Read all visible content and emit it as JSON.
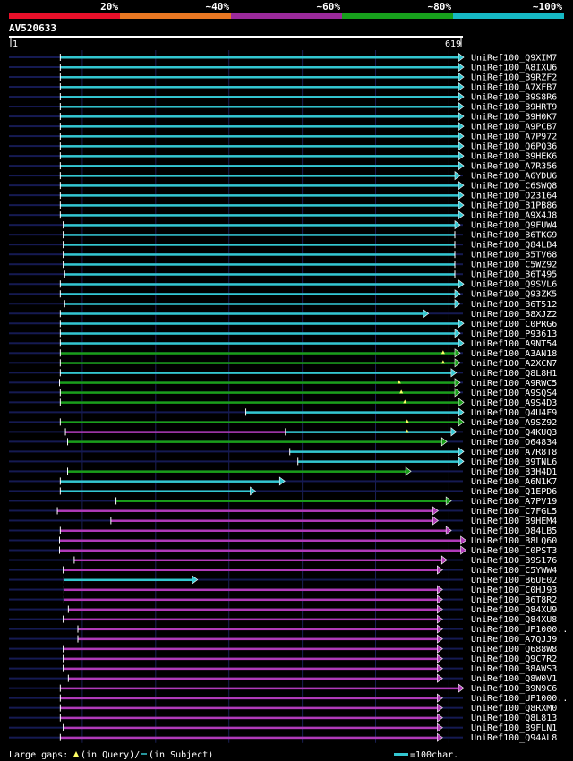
{
  "query_id": "AV520633",
  "identity_scale": [
    {
      "label": "20%",
      "color": "#e8102a"
    },
    {
      "label": "~40%",
      "color": "#e87722"
    },
    {
      "label": "~60%",
      "color": "#9b2a9b"
    },
    {
      "label": "~80%",
      "color": "#17a01c"
    },
    {
      "label": "~100%",
      "color": "#16b9c4"
    }
  ],
  "ruler": {
    "start": "1",
    "end": "619",
    "length": 619
  },
  "legend": {
    "large_gaps": "Large gaps:",
    "in_query": "(in Query)/",
    "in_subject": "(in Subject)",
    "scale_text": "=100char.",
    "gap_icon": "triangle-icon"
  },
  "hits": [
    {
      "id": "UniRef100_Q9XIM7",
      "start": 70,
      "end": 613,
      "color": "teal",
      "arrow": true
    },
    {
      "id": "UniRef100_A8IXU6",
      "start": 70,
      "end": 613,
      "color": "teal",
      "arrow": true
    },
    {
      "id": "UniRef100_B9RZF2",
      "start": 70,
      "end": 613,
      "color": "teal",
      "arrow": true
    },
    {
      "id": "UniRef100_A7XFB7",
      "start": 70,
      "end": 613,
      "color": "teal",
      "arrow": true
    },
    {
      "id": "UniRef100_B9S8R6",
      "start": 70,
      "end": 613,
      "color": "teal",
      "arrow": true
    },
    {
      "id": "UniRef100_B9HRT9",
      "start": 70,
      "end": 613,
      "color": "teal",
      "arrow": true
    },
    {
      "id": "UniRef100_B9H0K7",
      "start": 70,
      "end": 613,
      "color": "teal",
      "arrow": true
    },
    {
      "id": "UniRef100_A9PCB7",
      "start": 70,
      "end": 613,
      "color": "teal",
      "arrow": true
    },
    {
      "id": "UniRef100_A7P972",
      "start": 70,
      "end": 613,
      "color": "teal",
      "arrow": true
    },
    {
      "id": "UniRef100_Q6PQ36",
      "start": 70,
      "end": 613,
      "color": "teal",
      "arrow": true
    },
    {
      "id": "UniRef100_B9HEK6",
      "start": 70,
      "end": 613,
      "color": "teal",
      "arrow": true
    },
    {
      "id": "UniRef100_A7R356",
      "start": 70,
      "end": 613,
      "color": "teal",
      "arrow": true
    },
    {
      "id": "UniRef100_A6YDU6",
      "start": 70,
      "end": 608,
      "color": "teal",
      "arrow": true
    },
    {
      "id": "UniRef100_C6SWQ8",
      "start": 70,
      "end": 613,
      "color": "teal",
      "arrow": true
    },
    {
      "id": "UniRef100_O23164",
      "start": 70,
      "end": 613,
      "color": "teal",
      "arrow": true
    },
    {
      "id": "UniRef100_B1PB86",
      "start": 70,
      "end": 613,
      "color": "teal",
      "arrow": true
    },
    {
      "id": "UniRef100_A9X4J8",
      "start": 70,
      "end": 613,
      "color": "teal",
      "arrow": true
    },
    {
      "id": "UniRef100_Q9FUW4",
      "start": 74,
      "end": 608,
      "color": "teal",
      "arrow": true
    },
    {
      "id": "UniRef100_B6TKG9",
      "start": 74,
      "end": 608,
      "color": "teal",
      "arrow": false
    },
    {
      "id": "UniRef100_Q84LB4",
      "start": 74,
      "end": 608,
      "color": "teal",
      "arrow": false
    },
    {
      "id": "UniRef100_B5TV68",
      "start": 74,
      "end": 608,
      "color": "teal",
      "arrow": false
    },
    {
      "id": "UniRef100_C5WZ92",
      "start": 74,
      "end": 608,
      "color": "teal",
      "arrow": false
    },
    {
      "id": "UniRef100_B6T495",
      "start": 76,
      "end": 608,
      "color": "teal",
      "arrow": false
    },
    {
      "id": "UniRef100_Q9SVL6",
      "start": 70,
      "end": 613,
      "color": "teal",
      "arrow": true
    },
    {
      "id": "UniRef100_Q93ZK5",
      "start": 70,
      "end": 608,
      "color": "teal",
      "arrow": true
    },
    {
      "id": "UniRef100_B6T512",
      "start": 76,
      "end": 608,
      "color": "teal",
      "arrow": true
    },
    {
      "id": "UniRef100_B8XJZ2",
      "start": 70,
      "end": 565,
      "color": "teal",
      "arrow": true
    },
    {
      "id": "UniRef100_C0PRG6",
      "start": 70,
      "end": 613,
      "color": "teal",
      "arrow": true
    },
    {
      "id": "UniRef100_P93613",
      "start": 70,
      "end": 608,
      "color": "teal",
      "arrow": true
    },
    {
      "id": "UniRef100_A9NT54",
      "start": 70,
      "end": 613,
      "color": "teal",
      "arrow": true
    },
    {
      "id": "UniRef100_A3AN18",
      "start": 70,
      "end": 608,
      "color": "green",
      "arrow": true,
      "gap_q": 592
    },
    {
      "id": "UniRef100_A2XCN7",
      "start": 70,
      "end": 608,
      "color": "green",
      "arrow": true,
      "gap_q": 592
    },
    {
      "id": "UniRef100_Q8L8H1",
      "start": 70,
      "end": 603,
      "color": "teal",
      "arrow": true
    },
    {
      "id": "UniRef100_A9RWC5",
      "start": 69,
      "end": 608,
      "color": "green",
      "arrow": true,
      "gap_q": 532
    },
    {
      "id": "UniRef100_A9SQS4",
      "start": 70,
      "end": 608,
      "color": "green",
      "arrow": true,
      "gap_q": 535
    },
    {
      "id": "UniRef100_A9S4D3",
      "start": 70,
      "end": 613,
      "color": "green",
      "arrow": true,
      "gap_q": 540
    },
    {
      "id": "UniRef100_Q4U4F9",
      "start": 323,
      "end": 613,
      "color": "teal",
      "arrow": true
    },
    {
      "id": "UniRef100_A9SZ92",
      "start": 70,
      "end": 613,
      "color": "green",
      "arrow": true,
      "gap_q": 543
    },
    {
      "id": "UniRef100_Q4KUQ3",
      "start": 77,
      "end": 603,
      "color": "purple",
      "arrow": true,
      "split": 377,
      "gap_q": 543
    },
    {
      "id": "UniRef100_O64834",
      "start": 80,
      "end": 590,
      "color": "green",
      "arrow": true
    },
    {
      "id": "UniRef100_A7R8T8",
      "start": 383,
      "end": 613,
      "color": "teal",
      "arrow": true
    },
    {
      "id": "UniRef100_B9TNL6",
      "start": 394,
      "end": 613,
      "color": "teal",
      "arrow": true
    },
    {
      "id": "UniRef100_B3H4D1",
      "start": 80,
      "end": 541,
      "color": "green",
      "arrow": true
    },
    {
      "id": "UniRef100_A6N1K7",
      "start": 70,
      "end": 369,
      "color": "teal",
      "arrow": true
    },
    {
      "id": "UniRef100_Q1EPD6",
      "start": 70,
      "end": 329,
      "color": "teal",
      "arrow": true
    },
    {
      "id": "UniRef100_A7PV19",
      "start": 146,
      "end": 596,
      "color": "green",
      "arrow": true
    },
    {
      "id": "UniRef100_C7FGL5",
      "start": 66,
      "end": 578,
      "color": "purple",
      "arrow": true
    },
    {
      "id": "UniRef100_B9HEM4",
      "start": 139,
      "end": 578,
      "color": "purple",
      "arrow": true
    },
    {
      "id": "UniRef100_Q84LB5",
      "start": 70,
      "end": 596,
      "color": "purple",
      "arrow": true
    },
    {
      "id": "UniRef100_B8LQ60",
      "start": 69,
      "end": 616,
      "color": "purple",
      "arrow": true
    },
    {
      "id": "UniRef100_C0PST3",
      "start": 69,
      "end": 616,
      "color": "purple",
      "arrow": true
    },
    {
      "id": "UniRef100_B9S176",
      "start": 89,
      "end": 590,
      "color": "purple",
      "arrow": true
    },
    {
      "id": "UniRef100_C5YWW4",
      "start": 74,
      "end": 584,
      "color": "purple",
      "arrow": true
    },
    {
      "id": "UniRef100_B6UE02",
      "start": 75,
      "end": 250,
      "color": "teal",
      "arrow": true
    },
    {
      "id": "UniRef100_C0HJ93",
      "start": 75,
      "end": 584,
      "color": "purple",
      "arrow": true
    },
    {
      "id": "UniRef100_B6T8R2",
      "start": 75,
      "end": 584,
      "color": "purple",
      "arrow": true
    },
    {
      "id": "UniRef100_Q84XU9",
      "start": 81,
      "end": 584,
      "color": "purple",
      "arrow": true
    },
    {
      "id": "UniRef100_Q84XU8",
      "start": 74,
      "end": 584,
      "color": "purple",
      "arrow": true
    },
    {
      "id": "UniRef100_UP1000..",
      "start": 94,
      "end": 584,
      "color": "purple",
      "arrow": true
    },
    {
      "id": "UniRef100_A7QJJ9",
      "start": 94,
      "end": 584,
      "color": "purple",
      "arrow": true
    },
    {
      "id": "UniRef100_Q688W8",
      "start": 74,
      "end": 584,
      "color": "purple",
      "arrow": true
    },
    {
      "id": "UniRef100_Q9C7R2",
      "start": 74,
      "end": 584,
      "color": "purple",
      "arrow": true
    },
    {
      "id": "UniRef100_B8AWS3",
      "start": 74,
      "end": 584,
      "color": "purple",
      "arrow": true
    },
    {
      "id": "UniRef100_Q8W0V1",
      "start": 81,
      "end": 584,
      "color": "purple",
      "arrow": true
    },
    {
      "id": "UniRef100_B9N9C6",
      "start": 70,
      "end": 613,
      "color": "purple",
      "arrow": true
    },
    {
      "id": "UniRef100_UP1000..",
      "start": 70,
      "end": 584,
      "color": "purple",
      "arrow": true
    },
    {
      "id": "UniRef100_Q8RXM0",
      "start": 70,
      "end": 584,
      "color": "purple",
      "arrow": true
    },
    {
      "id": "UniRef100_Q8L813",
      "start": 70,
      "end": 584,
      "color": "purple",
      "arrow": true
    },
    {
      "id": "UniRef100_B9FLN1",
      "start": 74,
      "end": 584,
      "color": "purple",
      "arrow": true
    },
    {
      "id": "UniRef100_Q94AL8",
      "start": 70,
      "end": 584,
      "color": "purple",
      "arrow": true
    }
  ],
  "colors": {
    "teal": "#33c7d1",
    "green": "#1a9e1a",
    "purple": "#b03ab8",
    "navy": "#151a52",
    "grid": "#1a1f56",
    "gap_marker": "#ffff66"
  }
}
